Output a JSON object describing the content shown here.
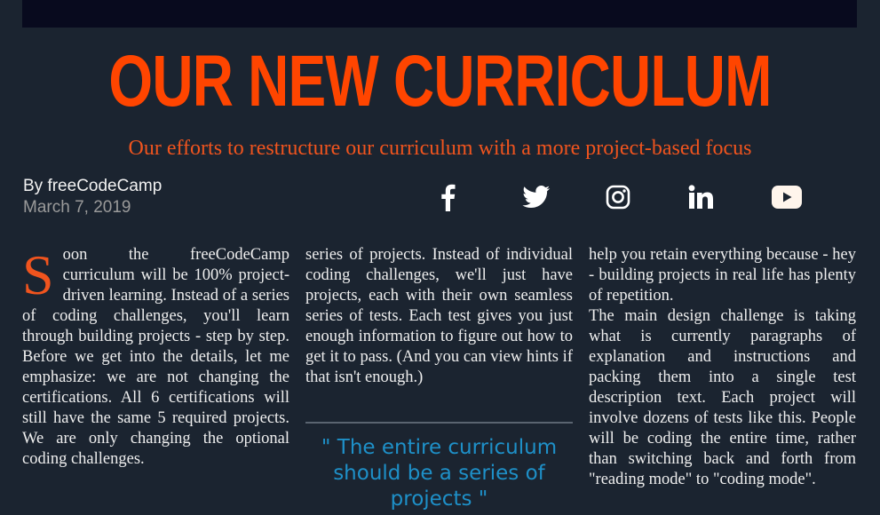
{
  "article": {
    "title": "OUR NEW CURRICULUM",
    "subtitle": "Our efforts to restructure our curriculum with a more project-based focus",
    "author": "By freeCodeCamp",
    "date": "March 7, 2019"
  },
  "social": [
    {
      "icon": "facebook-icon"
    },
    {
      "icon": "twitter-icon"
    },
    {
      "icon": "instagram-icon"
    },
    {
      "icon": "linkedin-icon"
    },
    {
      "icon": "youtube-icon"
    }
  ],
  "body": {
    "dropcap": "S",
    "col1_text": "oon the freeCodeCamp curriculum will be 100% project-driven learning. Instead of a series of coding challenges, you'll learn through building projects - step by step. Before we get into the details, let me emphasize: we are not changing the certifications. All 6 certifications will still have the same 5 required projects. We are only changing the optional coding challenges.",
    "col2_text": "series of projects. Instead of individual coding challenges, we'll just have projects, each with their own seamless series of tests. Each test gives you just enough information to figure out how to get it to pass. (And you can view hints if that isn't enough.)",
    "quote": "\" The entire curriculum should be a series of projects \"",
    "col3_p1": "help you retain everything because - hey - building projects in real life has plenty of repetition.",
    "col3_p2": "The main design challenge is taking what is currently paragraphs of explanation and instructions and packing them into a single test description text. Each project will involve dozens of tests like this. People will be coding the entire time, rather than switching back and forth from \"reading mode\" to \"coding mode\"."
  },
  "colors": {
    "background": "#1b2430",
    "accent": "#ff4500",
    "quote": "#1e90c8"
  }
}
